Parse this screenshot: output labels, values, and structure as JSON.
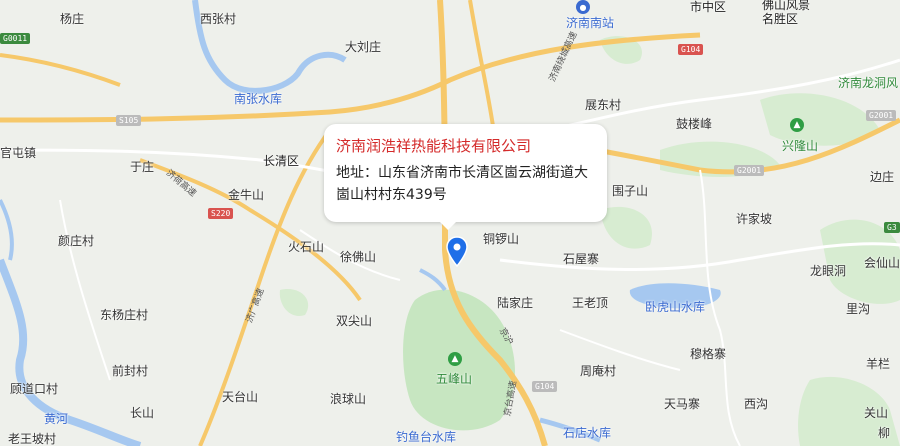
{
  "popup": {
    "title": "济南润浩祥热能科技有限公司",
    "address_prefix": "地址：",
    "address": "山东省济南市长清区崮云湖街道大崮山村村东439号"
  },
  "places": [
    {
      "key": "yangzhuang",
      "name": "杨庄",
      "kind": "place"
    },
    {
      "key": "xizhangcun",
      "name": "西张村",
      "kind": "place"
    },
    {
      "key": "dalizhuang",
      "name": "大刘庄",
      "kind": "place"
    },
    {
      "key": "jinan_south_station",
      "name": "济南南站",
      "kind": "water"
    },
    {
      "key": "shizhongqu",
      "name": "市中区",
      "kind": "district"
    },
    {
      "key": "fohuishan",
      "name": "佛山风景名胜区",
      "kind": "district"
    },
    {
      "key": "nanzhang_reservoir",
      "name": "南张水库",
      "kind": "water"
    },
    {
      "key": "zhanzhuang",
      "name": "展东村",
      "kind": "place"
    },
    {
      "key": "gudunfeng",
      "name": "鼓楼峰",
      "kind": "place"
    },
    {
      "key": "longdong",
      "name": "济南龙洞风",
      "kind": "scenic"
    },
    {
      "key": "guantunzhen",
      "name": "官屯镇",
      "kind": "place"
    },
    {
      "key": "yuzhuang",
      "name": "于庄",
      "kind": "place"
    },
    {
      "key": "changqingqu",
      "name": "长清区",
      "kind": "district"
    },
    {
      "key": "xinglongshan",
      "name": "兴隆山",
      "kind": "scenic"
    },
    {
      "key": "jinniushan",
      "name": "金牛山",
      "kind": "place"
    },
    {
      "key": "guoziahan",
      "name": "围子山",
      "kind": "place"
    },
    {
      "key": "bianzhuang",
      "name": "边庄",
      "kind": "place"
    },
    {
      "key": "xujiapo",
      "name": "许家坡",
      "kind": "place"
    },
    {
      "key": "yanzuncun",
      "name": "颜庄村",
      "kind": "place"
    },
    {
      "key": "huoshishan",
      "name": "火石山",
      "kind": "place"
    },
    {
      "key": "xufoshan",
      "name": "徐佛山",
      "kind": "place"
    },
    {
      "key": "tongluoshan",
      "name": "铜锣山",
      "kind": "place"
    },
    {
      "key": "shiwuzhai",
      "name": "石屋寨",
      "kind": "place"
    },
    {
      "key": "longyandong",
      "name": "龙眼洞",
      "kind": "place"
    },
    {
      "key": "huixianshan",
      "name": "会仙山",
      "kind": "place"
    },
    {
      "key": "lujiazhuang",
      "name": "陆家庄",
      "kind": "place"
    },
    {
      "key": "wanglaoding",
      "name": "王老顶",
      "kind": "place"
    },
    {
      "key": "wohushan_reservoir",
      "name": "卧虎山水库",
      "kind": "water"
    },
    {
      "key": "ligou",
      "name": "里沟",
      "kind": "place"
    },
    {
      "key": "dongyangzhuang",
      "name": "东杨庄村",
      "kind": "place"
    },
    {
      "key": "shuangjianshan",
      "name": "双尖山",
      "kind": "place"
    },
    {
      "key": "wufengshan",
      "name": "五峰山",
      "kind": "scenic"
    },
    {
      "key": "mugezhai",
      "name": "穆格寨",
      "kind": "place"
    },
    {
      "key": "yangshi",
      "name": "羊栏",
      "kind": "place"
    },
    {
      "key": "qiancaicun",
      "name": "前封村",
      "kind": "place"
    },
    {
      "key": "zhouzhuang",
      "name": "周庵村",
      "kind": "place"
    },
    {
      "key": "gudaokou",
      "name": "顾道口村",
      "kind": "place"
    },
    {
      "key": "tiantaishan",
      "name": "天台山",
      "kind": "place"
    },
    {
      "key": "langqiushan",
      "name": "浪球山",
      "kind": "place"
    },
    {
      "key": "tianmazhai",
      "name": "天马寨",
      "kind": "place"
    },
    {
      "key": "xigou",
      "name": "西沟",
      "kind": "place"
    },
    {
      "key": "changshan",
      "name": "长山",
      "kind": "place"
    },
    {
      "key": "guanshan",
      "name": "关山",
      "kind": "place"
    },
    {
      "key": "laozhuang",
      "name": "老王坡村",
      "kind": "place"
    },
    {
      "key": "diaoyutai",
      "name": "钓鱼台水库",
      "kind": "water"
    },
    {
      "key": "shidian_reservoir",
      "name": "石店水库",
      "kind": "water"
    },
    {
      "key": "huanghe",
      "name": "黄河",
      "kind": "water"
    },
    {
      "key": "liu",
      "name": "柳",
      "kind": "place"
    }
  ],
  "shields": [
    {
      "key": "g104_top",
      "label": "G104",
      "kind": "national"
    },
    {
      "key": "s105",
      "label": "S105",
      "kind": "grey"
    },
    {
      "key": "g2001_a",
      "label": "G2001",
      "kind": "grey"
    },
    {
      "key": "g2001_b",
      "label": "G2001",
      "kind": "grey"
    },
    {
      "key": "s220",
      "label": "S220",
      "kind": "national"
    },
    {
      "key": "g104_bottom",
      "label": "G104",
      "kind": "grey"
    },
    {
      "key": "g0011",
      "label": "G0011",
      "kind": "expressway"
    },
    {
      "key": "g3_right",
      "label": "G3",
      "kind": "expressway"
    }
  ],
  "road_labels": [
    {
      "key": "jiguan_expressway",
      "text": "济荷高速"
    },
    {
      "key": "jinan_ring",
      "text": "济南绕城高速"
    },
    {
      "key": "jiguang_expressway",
      "text": "济广高速"
    },
    {
      "key": "jingtai_expressway",
      "text": "京台高速"
    },
    {
      "key": "jinghu",
      "text": "京沪"
    }
  ],
  "colors": {
    "background": "#eef0eb",
    "water": "#a6c8f0",
    "green": "#c7e6c1",
    "road_major": "#f6c86a",
    "road_minor": "#ffffff",
    "marker": "#1f6fe8",
    "title": "#d42a2a"
  },
  "marker": {
    "icon": "map-pin-icon"
  }
}
